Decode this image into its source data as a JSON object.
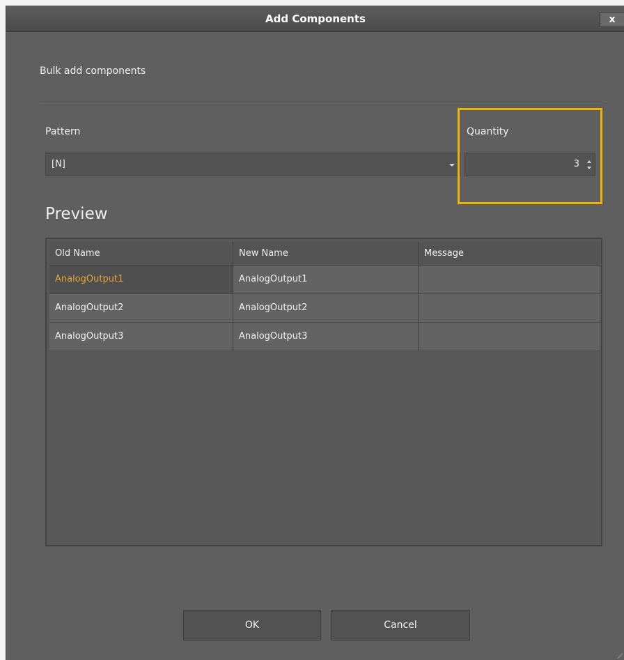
{
  "dialog": {
    "title": "Add Components",
    "close_glyph": "x",
    "subtitle": "Bulk add components"
  },
  "pattern": {
    "label": "Pattern",
    "value": "[N]"
  },
  "quantity": {
    "label": "Quantity",
    "value": "3",
    "highlight_color": "#f0b400"
  },
  "preview": {
    "heading": "Preview",
    "columns": [
      "Old Name",
      "New Name",
      "Message"
    ],
    "rows": [
      {
        "old": "AnalogOutput1",
        "new": "AnalogOutput1",
        "message": ""
      },
      {
        "old": "AnalogOutput2",
        "new": "AnalogOutput2",
        "message": ""
      },
      {
        "old": "AnalogOutput3",
        "new": "AnalogOutput3",
        "message": ""
      }
    ]
  },
  "buttons": {
    "ok": "OK",
    "cancel": "Cancel"
  },
  "icons": [
    "close-icon",
    "dropdown-arrow-icon",
    "spin-up-icon",
    "spin-down-icon",
    "resize-grip-icon"
  ]
}
